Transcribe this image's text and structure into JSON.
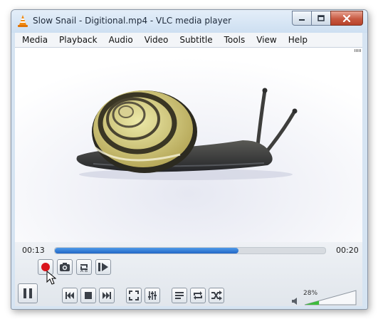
{
  "window": {
    "title": "Slow Snail - Digitional.mp4 - VLC media player"
  },
  "menu": [
    "Media",
    "Playback",
    "Audio",
    "Video",
    "Subtitle",
    "Tools",
    "View",
    "Help"
  ],
  "playback": {
    "elapsed": "00:13",
    "total": "00:20",
    "progress": 0.68
  },
  "volume": {
    "label": "28%",
    "level": 0.28
  },
  "colors": {
    "accent": "#2468c8",
    "record": "#d9141b",
    "titlebar": "#dbe8f5",
    "close": "#c85a42",
    "volume": "#3dbb3d"
  },
  "icons": {
    "app": "vlc-cone-icon",
    "record": "record-icon",
    "snapshot": "camera-icon",
    "loop_ab": "loop-ab-icon",
    "frame": "frame-step-icon",
    "pause": "pause-icon",
    "previous": "previous-icon",
    "stop": "stop-icon",
    "next": "next-icon",
    "fullscreen": "fullscreen-icon",
    "extended": "equalizer-icon",
    "playlist": "playlist-icon",
    "loop": "loop-icon",
    "shuffle": "shuffle-icon",
    "mute": "speaker-icon"
  }
}
